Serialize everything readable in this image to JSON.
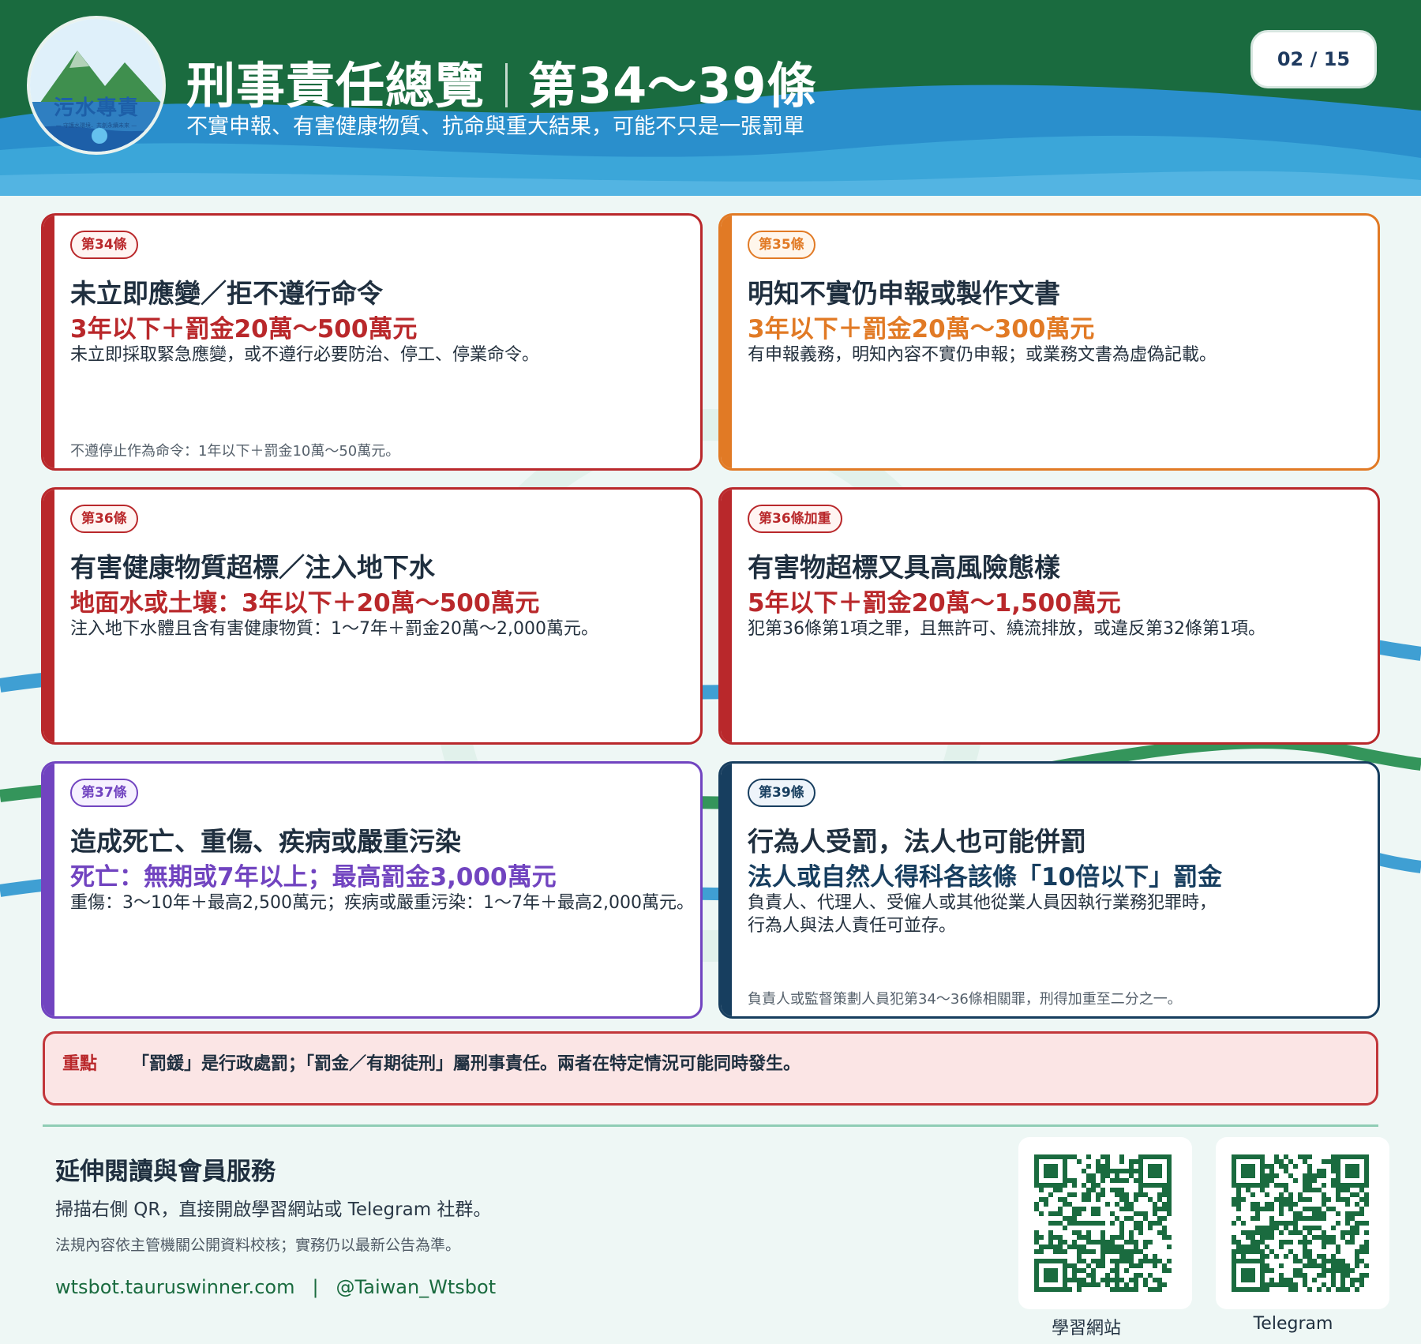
{
  "header": {
    "logo_text": "污水專責",
    "logo_sub": "— 守護水環境．共創永續未來 —",
    "title_main": "刑事責任總覽",
    "title_articles": "第34～39條",
    "subtitle": "不實申報、有害健康物質、抗命與重大結果，可能不只是一張罰單",
    "page_indicator": "02 / 15"
  },
  "cards": [
    {
      "tag": "第34條",
      "title": "未立即應變／拒不遵行命令",
      "penalty": "3年以下＋罰金20萬～500萬元",
      "desc": [
        "未立即採取緊急應變，或不遵行必要防治、停工、停業命令。"
      ],
      "note": "不遵停止作為命令：1年以下＋罰金10萬～50萬元。"
    },
    {
      "tag": "第35條",
      "title": "明知不實仍申報或製作文書",
      "penalty": "3年以下＋罰金20萬～300萬元",
      "desc": [
        "有申報義務，明知內容不實仍申報；或業務文書為虛偽記載。"
      ],
      "note": ""
    },
    {
      "tag": "第36條",
      "title": "有害健康物質超標／注入地下水",
      "penalty": "地面水或土壤：3年以下＋20萬～500萬元",
      "desc": [
        "注入地下水體且含有害健康物質：1～7年＋罰金20萬～2,000萬元。"
      ],
      "note": ""
    },
    {
      "tag": "第36條加重",
      "title": "有害物超標又具高風險態樣",
      "penalty": "5年以下＋罰金20萬～1,500萬元",
      "desc": [
        "犯第36條第1項之罪，且無許可、繞流排放，或違反第32條第1項。"
      ],
      "note": ""
    },
    {
      "tag": "第37條",
      "title": "造成死亡、重傷、疾病或嚴重污染",
      "penalty": "死亡：無期或7年以上；最高罰金3,000萬元",
      "desc": [
        "重傷：3～10年＋最高2,500萬元；疾病或嚴重污染：1～7年＋最高2,000萬元。"
      ],
      "note": ""
    },
    {
      "tag": "第39條",
      "title": "行為人受罰，法人也可能併罰",
      "penalty": "法人或自然人得科各該條「10倍以下」罰金",
      "desc": [
        "負責人、代理人、受僱人或其他從業人員因執行業務犯罪時，",
        "行為人與法人責任可並存。"
      ],
      "note": "負責人或監督策劃人員犯第34～36條相關罪，刑得加重至二分之一。"
    }
  ],
  "keypoint": {
    "label": "重點",
    "text": "「罰鍰」是行政處罰；「罰金／有期徒刑」屬刑事責任。兩者在特定情況可能同時發生。"
  },
  "footer": {
    "title": "延伸閱讀與會員服務",
    "line": "掃描右側 QR，直接開啟學習網站或 Telegram 社群。",
    "legal": "法規內容依主管機關公開資料校核；實務仍以最新公告為準。",
    "site": "wtsbot.tauruswinner.com",
    "separator": "|",
    "telegram_handle": "@Taiwan_Wtsbot",
    "qr": [
      {
        "label": "學習網站"
      },
      {
        "label": "Telegram"
      }
    ]
  },
  "colors": {
    "header_green": "#1a6b3f",
    "header_blue": "#2a8fcc",
    "red": "#b9282b",
    "orange": "#e17a25",
    "purple": "#7144c0",
    "navy": "#173e5f"
  }
}
